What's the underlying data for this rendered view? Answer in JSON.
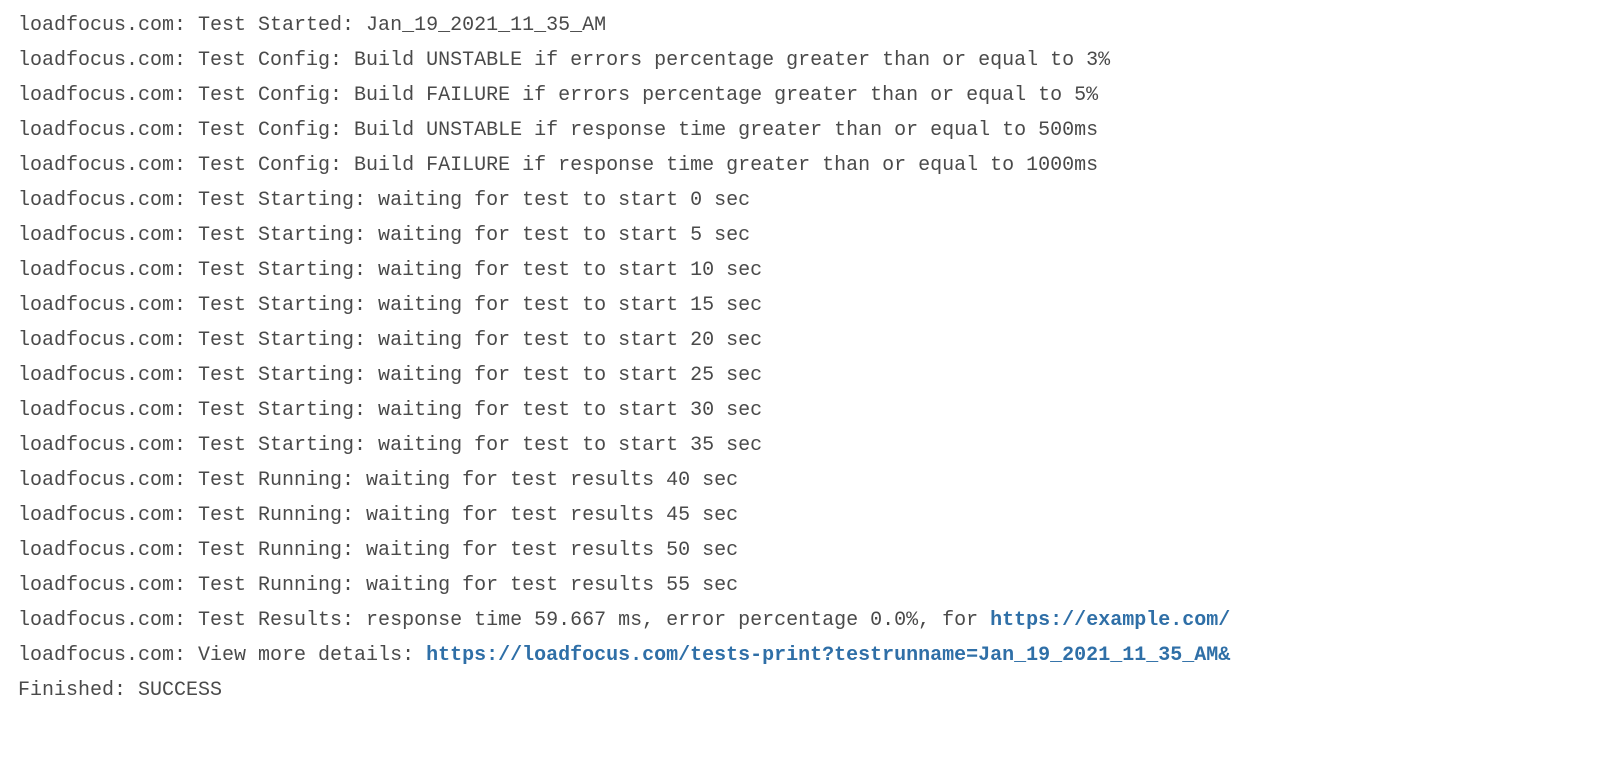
{
  "log": {
    "lines": [
      {
        "prefix": "loadfocus.com: ",
        "text": "Test Started: Jan_19_2021_11_35_AM"
      },
      {
        "prefix": "loadfocus.com: ",
        "text": "Test Config: Build UNSTABLE if errors percentage greater than or equal to 3%"
      },
      {
        "prefix": "loadfocus.com: ",
        "text": "Test Config: Build FAILURE if errors percentage greater than or equal to 5%"
      },
      {
        "prefix": "loadfocus.com: ",
        "text": "Test Config: Build UNSTABLE if response time greater than or equal to 500ms"
      },
      {
        "prefix": "loadfocus.com: ",
        "text": "Test Config: Build FAILURE if response time greater than or equal to 1000ms"
      },
      {
        "prefix": "loadfocus.com: ",
        "text": "Test Starting: waiting for test to start 0 sec"
      },
      {
        "prefix": "loadfocus.com: ",
        "text": "Test Starting: waiting for test to start 5 sec"
      },
      {
        "prefix": "loadfocus.com: ",
        "text": "Test Starting: waiting for test to start 10 sec"
      },
      {
        "prefix": "loadfocus.com: ",
        "text": "Test Starting: waiting for test to start 15 sec"
      },
      {
        "prefix": "loadfocus.com: ",
        "text": "Test Starting: waiting for test to start 20 sec"
      },
      {
        "prefix": "loadfocus.com: ",
        "text": "Test Starting: waiting for test to start 25 sec"
      },
      {
        "prefix": "loadfocus.com: ",
        "text": "Test Starting: waiting for test to start 30 sec"
      },
      {
        "prefix": "loadfocus.com: ",
        "text": "Test Starting: waiting for test to start 35 sec"
      },
      {
        "prefix": "loadfocus.com: ",
        "text": "Test Running: waiting for test results 40 sec"
      },
      {
        "prefix": "loadfocus.com: ",
        "text": "Test Running: waiting for test results 45 sec"
      },
      {
        "prefix": "loadfocus.com: ",
        "text": "Test Running: waiting for test results 50 sec"
      },
      {
        "prefix": "loadfocus.com: ",
        "text": "Test Running: waiting for test results 55 sec"
      },
      {
        "prefix": "loadfocus.com: ",
        "text": "Test Results: response time 59.667 ms, error percentage 0.0%, for ",
        "link": "https://example.com/"
      },
      {
        "prefix": "loadfocus.com: ",
        "text": "View more details: ",
        "link": "https://loadfocus.com/tests-print?testrunname=Jan_19_2021_11_35_AM&"
      },
      {
        "prefix": "",
        "text": "Finished: SUCCESS"
      }
    ]
  }
}
